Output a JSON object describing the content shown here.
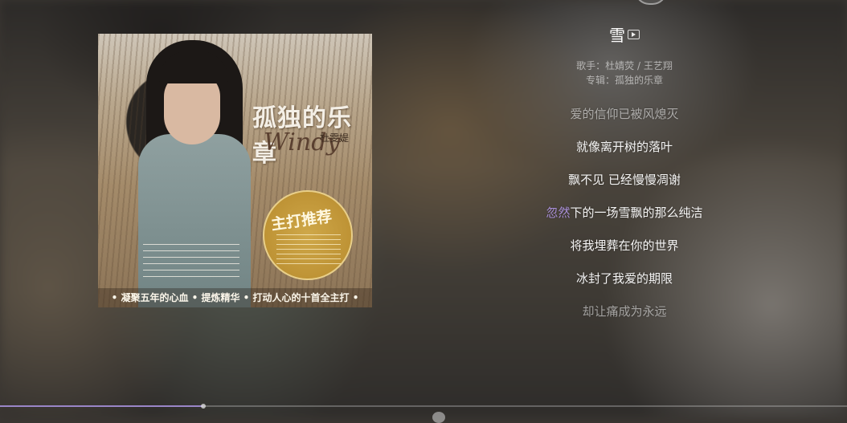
{
  "album_cover": {
    "title_text": "孤独的乐章",
    "artist_text": "杜雯媞",
    "script_text": "Windy",
    "seal_text": "主打推荐",
    "banner_text": "• 凝聚五年的心血 • 提炼精华 • 打动人心的十首全主打 •"
  },
  "song": {
    "title": "雪",
    "artist_line": "歌手：杜婧荧 / 王艺翔",
    "album_line": "专辑：孤独的乐章"
  },
  "lyrics": [
    {
      "text": "爱的信仰已被风熄灭",
      "state": "faded"
    },
    {
      "text": "就像离开树的落叶",
      "state": "normal"
    },
    {
      "text": "飘不见 已经慢慢凋谢",
      "state": "normal"
    },
    {
      "sung": "忽然",
      "rest": "下的一场雪飘的那么纯洁",
      "state": "current"
    },
    {
      "text": "将我埋葬在你的世界",
      "state": "normal"
    },
    {
      "text": "冰封了我爱的期限",
      "state": "normal"
    },
    {
      "text": "却让痛成为永远",
      "state": "faded"
    }
  ],
  "playback": {
    "progress_fraction": 0.24
  },
  "colors": {
    "accent": "#a98fd8",
    "progress": "#9a86c8"
  },
  "icons": {
    "mv": "mv-icon"
  }
}
